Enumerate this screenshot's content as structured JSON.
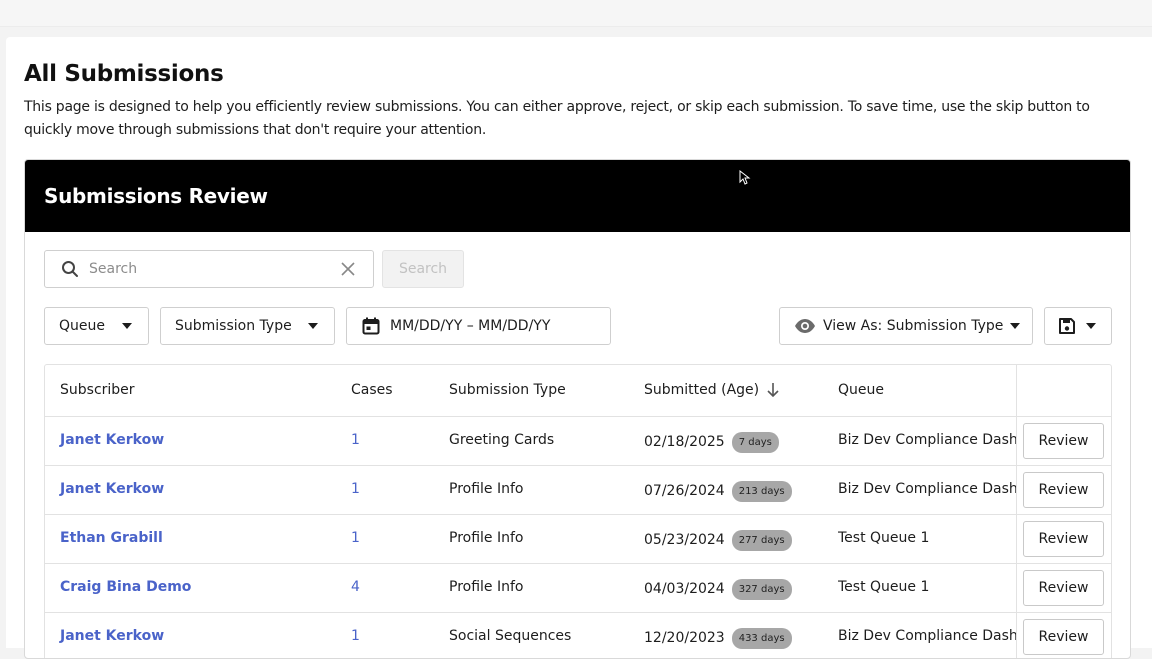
{
  "page": {
    "title": "All Submissions",
    "description": "This page is designed to help you efficiently review submissions. You can either approve, reject, or skip each submission. To save time, use the skip button to quickly move through submissions that don't require your attention."
  },
  "panel": {
    "title": "Submissions Review"
  },
  "search": {
    "placeholder": "Search",
    "button_label": "Search"
  },
  "filters": {
    "queue_label": "Queue",
    "submission_type_label": "Submission Type",
    "date_range_label": "MM/DD/YY – MM/DD/YY",
    "view_as_label": "View As: Submission Type"
  },
  "table": {
    "headers": {
      "subscriber": "Subscriber",
      "cases": "Cases",
      "submission_type": "Submission Type",
      "submitted": "Submitted (Age)",
      "queue": "Queue"
    },
    "rows": [
      {
        "subscriber": "Janet Kerkow",
        "cases": "1",
        "type": "Greeting Cards",
        "date": "02/18/2025",
        "age": "7 days",
        "queue": "Biz Dev Compliance Dashboard",
        "action": "Review"
      },
      {
        "subscriber": "Janet Kerkow",
        "cases": "1",
        "type": "Profile Info",
        "date": "07/26/2024",
        "age": "213 days",
        "queue": "Biz Dev Compliance Dashboard",
        "action": "Review"
      },
      {
        "subscriber": "Ethan Grabill",
        "cases": "1",
        "type": "Profile Info",
        "date": "05/23/2024",
        "age": "277 days",
        "queue": "Test Queue 1",
        "action": "Review"
      },
      {
        "subscriber": "Craig Bina Demo",
        "cases": "4",
        "type": "Profile Info",
        "date": "04/03/2024",
        "age": "327 days",
        "queue": "Test Queue 1",
        "action": "Review"
      },
      {
        "subscriber": "Janet Kerkow",
        "cases": "1",
        "type": "Social Sequences",
        "date": "12/20/2023",
        "age": "433 days",
        "queue": "Biz Dev Compliance Dashboard",
        "action": "Review"
      }
    ]
  },
  "colors": {
    "link": "#4a63c9",
    "header_bg": "#000000",
    "age_badge": "#a7a7a7"
  },
  "icons": [
    "search-icon",
    "clear-icon",
    "caret-down-icon",
    "calendar-icon",
    "eye-icon",
    "save-icon",
    "arrow-down-icon"
  ]
}
